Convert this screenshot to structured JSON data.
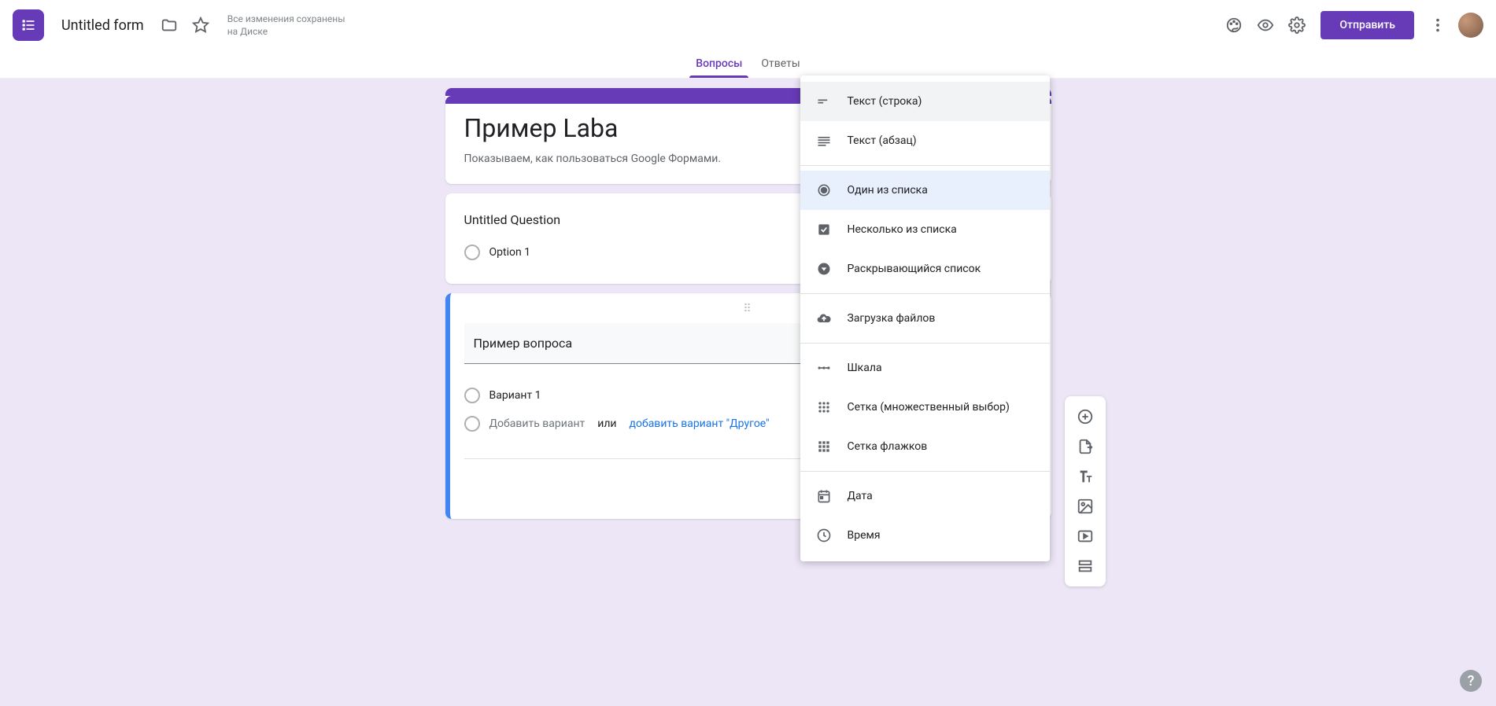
{
  "header": {
    "doc_title": "Untitled form",
    "save_status_l1": "Все изменения сохранены",
    "save_status_l2": "на Диске",
    "send_label": "Отправить"
  },
  "tabs": {
    "questions": "Вопросы",
    "responses": "Ответы"
  },
  "form": {
    "title": "Пример Laba",
    "description": "Показываем, как пользоваться Google Формами."
  },
  "question1": {
    "title": "Untitled Question",
    "option1": "Option 1"
  },
  "question2": {
    "title": "Пример вопроса",
    "option1": "Вариант 1",
    "add_option": "Добавить вариант",
    "or": "или",
    "add_other": "добавить вариант \"Другое\""
  },
  "dropdown": {
    "short_answer": "Текст (строка)",
    "paragraph": "Текст (абзац)",
    "multiple_choice": "Один из списка",
    "checkboxes": "Несколько из списка",
    "dropdown_list": "Раскрывающийся список",
    "file_upload": "Загрузка файлов",
    "linear_scale": "Шкала",
    "mc_grid": "Сетка (множественный выбор)",
    "checkbox_grid": "Сетка флажков",
    "date": "Дата",
    "time": "Время"
  },
  "help_char": "?"
}
